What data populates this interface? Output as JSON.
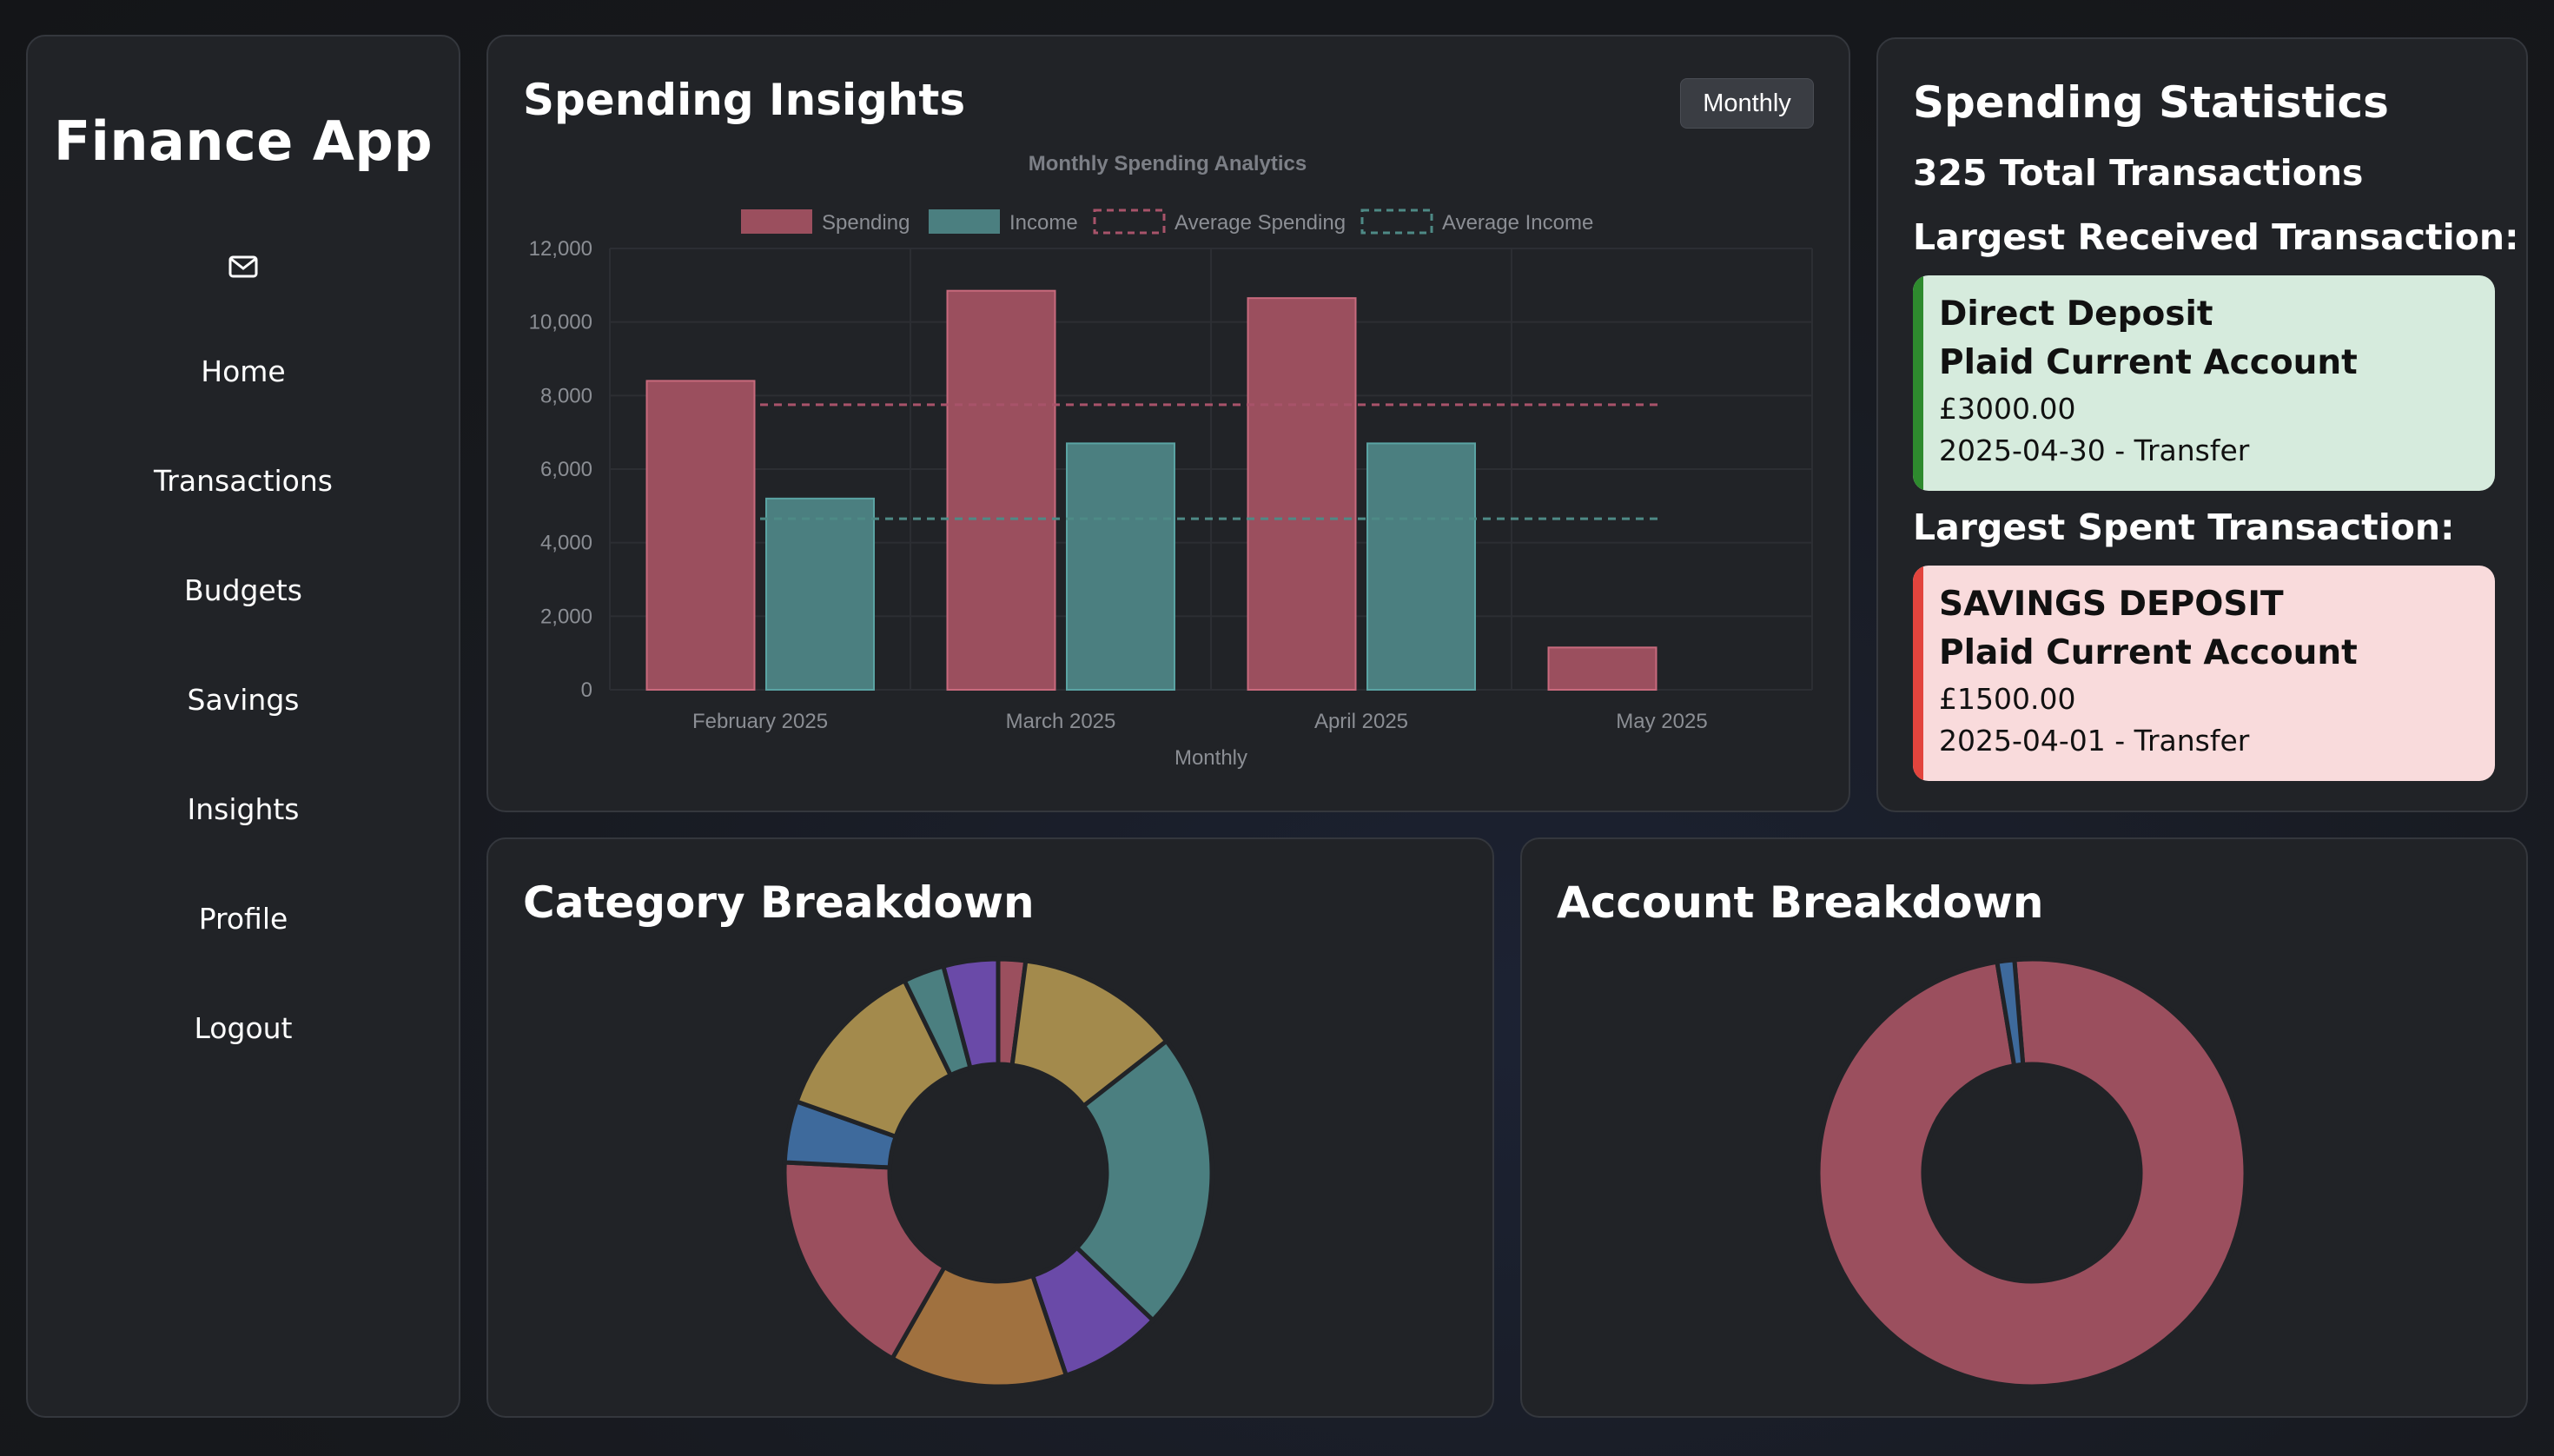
{
  "sidebar": {
    "app_title": "Finance App",
    "mail_icon": "envelope-icon",
    "items": [
      {
        "label": "Home"
      },
      {
        "label": "Transactions"
      },
      {
        "label": "Budgets"
      },
      {
        "label": "Savings"
      },
      {
        "label": "Insights"
      },
      {
        "label": "Profile"
      },
      {
        "label": "Logout"
      }
    ]
  },
  "insights": {
    "title": "Spending Insights",
    "period_button": "Monthly"
  },
  "chart_data": [
    {
      "type": "bar",
      "title": "Monthly Spending Analytics",
      "xlabel": "Monthly",
      "ylabel": "",
      "ylim": [
        0,
        12000
      ],
      "yticks": [
        "0",
        "2,000",
        "4,000",
        "6,000",
        "8,000",
        "10,000",
        "12,000"
      ],
      "categories": [
        "February 2025",
        "March 2025",
        "April 2025",
        "May 2025"
      ],
      "series": [
        {
          "name": "Spending",
          "values": [
            8400,
            10850,
            10650,
            1150
          ],
          "color": "#9b4f5e"
        },
        {
          "name": "Income",
          "values": [
            5200,
            6700,
            6700,
            0
          ],
          "color": "#4b7f80"
        }
      ],
      "average_lines": [
        {
          "name": "Average Spending",
          "value": 7750,
          "color": "#a8536a"
        },
        {
          "name": "Average Income",
          "value": 4650,
          "color": "#4e8a86"
        }
      ],
      "legend": "top",
      "grid": true
    },
    {
      "type": "pie",
      "variant": "doughnut",
      "values": [
        2,
        12,
        22,
        7.5,
        13,
        17,
        4.5,
        12,
        3,
        4
      ],
      "colors": [
        "#9b4f5e",
        "#a38a4c",
        "#4b7f80",
        "#6a4aa8",
        "#a0713f",
        "#9b4f5e",
        "#3e6a9c",
        "#a38a4c",
        "#4b7f80",
        "#6a4aa8"
      ]
    },
    {
      "type": "pie",
      "variant": "doughnut",
      "values": [
        98.7,
        1.3
      ],
      "colors": [
        "#9b4f5e",
        "#3e6a9c"
      ]
    }
  ],
  "stats": {
    "title": "Spending Statistics",
    "total_transactions": "325 Total Transactions",
    "largest_received_label": "Largest Received Transaction:",
    "largest_received": {
      "name": "Direct Deposit",
      "account": "Plaid Current Account",
      "amount": "£3000.00",
      "meta": "2025-04-30 - Transfer"
    },
    "largest_spent_label": "Largest Spent Transaction:",
    "largest_spent": {
      "name": "SAVINGS DEPOSIT",
      "account": "Plaid Current Account",
      "amount": "£1500.00",
      "meta": "2025-04-01 - Transfer"
    }
  },
  "category": {
    "title": "Category Breakdown"
  },
  "account": {
    "title": "Account Breakdown"
  }
}
